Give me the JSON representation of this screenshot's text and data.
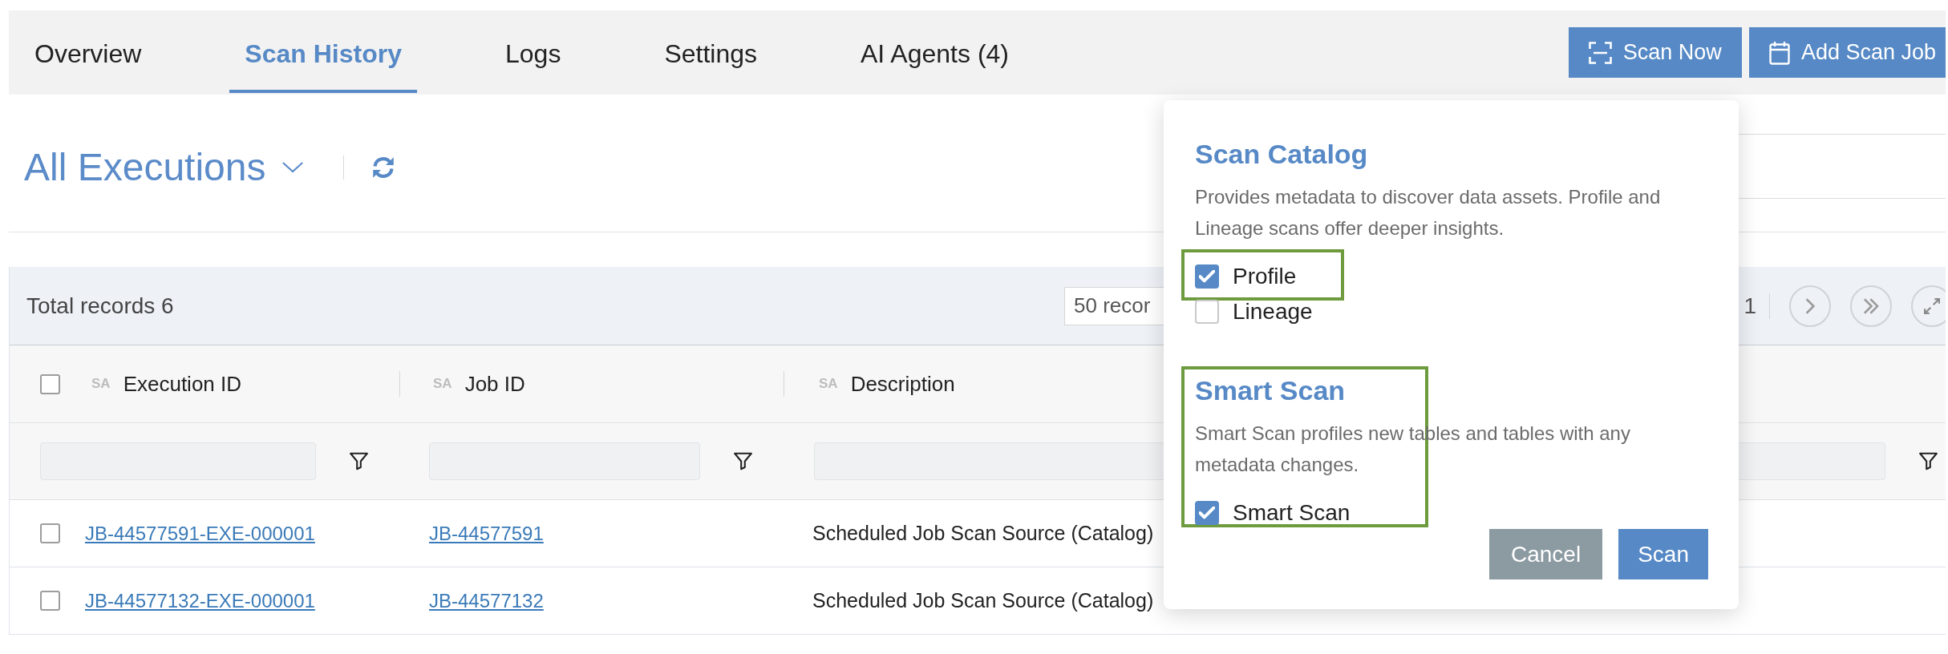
{
  "tabs": [
    {
      "label": "Overview",
      "selected": false
    },
    {
      "label": "Scan History",
      "selected": true
    },
    {
      "label": "Logs",
      "selected": false
    },
    {
      "label": "Settings",
      "selected": false
    },
    {
      "label": "AI Agents (4)",
      "selected": false
    }
  ],
  "actions": [
    {
      "label": "Scan Now",
      "kind": "scan"
    },
    {
      "label": "Add Scan Job",
      "kind": "calendar"
    }
  ],
  "view": {
    "title": "All Executions"
  },
  "table": {
    "total_records": "Total records 6",
    "page_size": "50 recor",
    "page": "1",
    "select_all": {
      "checked": false
    },
    "columns": [
      {
        "sort_tag": "SA",
        "label": "Execution ID"
      },
      {
        "sort_tag": "SA",
        "label": "Job ID"
      },
      {
        "sort_tag": "SA",
        "label": "Description"
      }
    ],
    "rows": [
      {
        "checked": false,
        "execution_id": "JB-44577591-EXE-000001",
        "job_id": "JB-44577591",
        "description": "Scheduled Job Scan Source (Catalog)"
      },
      {
        "checked": false,
        "execution_id": "JB-44577132-EXE-000001",
        "job_id": "JB-44577132",
        "description": "Scheduled Job Scan Source (Catalog)"
      }
    ]
  },
  "scan_popup": {
    "sections": [
      {
        "title": "Scan Catalog",
        "description": "Provides metadata to discover data assets. Profile and Lineage scans offer deeper insights.",
        "highlighted": false,
        "options": [
          {
            "label": "Profile",
            "checked": true,
            "highlighted": true
          },
          {
            "label": "Lineage",
            "checked": false,
            "highlighted": false
          }
        ]
      },
      {
        "title": "Smart Scan",
        "description": "Smart Scan profiles new tables and tables with any metadata changes.",
        "highlighted": true,
        "options": [
          {
            "label": "Smart Scan",
            "checked": true,
            "highlighted": false
          }
        ]
      }
    ],
    "buttons": [
      {
        "label": "Cancel",
        "kind": "secondary"
      },
      {
        "label": "Scan",
        "kind": "primary"
      }
    ]
  }
}
